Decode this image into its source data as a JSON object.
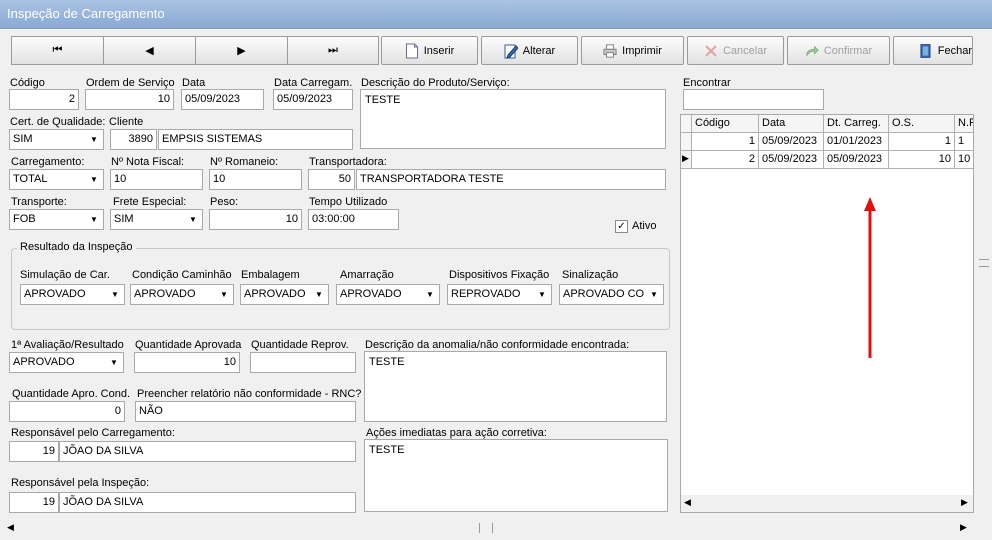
{
  "window": {
    "title": "Inspeção de Carregamento"
  },
  "nav": {
    "first": "⏮",
    "prev": "◀",
    "next": "▶",
    "last": "⏭"
  },
  "toolbar": {
    "insert": "Inserir",
    "edit": "Alterar",
    "print": "Imprimir",
    "cancel": "Cancelar",
    "confirm": "Confirmar",
    "close": "Fechar"
  },
  "form": {
    "codigo_label": "Código",
    "codigo": "2",
    "ordem_label": "Ordem de Serviço",
    "ordem": "10",
    "data_label": "Data",
    "data": "05/09/2023",
    "data_carreg_label": "Data Carregam.",
    "data_carreg": "05/09/2023",
    "descricao_label": "Descrição do Produto/Serviço:",
    "descricao": "TESTE",
    "cert_label": "Cert. de Qualidade:",
    "cert": "SIM",
    "cliente_label": "Cliente",
    "cliente_code": "3890",
    "cliente_name": "EMPSIS SISTEMAS",
    "carregamento_label": "Carregamento:",
    "carregamento": "TOTAL",
    "nota_label": "Nº Nota Fiscal:",
    "nota": "10",
    "romaneio_label": "Nº Romaneio:",
    "romaneio": "10",
    "transportadora_label": "Transportadora:",
    "transportadora_code": "50",
    "transportadora_name": "TRANSPORTADORA TESTE",
    "transporte_label": "Transporte:",
    "transporte": "FOB",
    "frete_label": "Frete Especial:",
    "frete": "SIM",
    "peso_label": "Peso:",
    "peso": "10",
    "tempo_label": "Tempo Utilizado",
    "tempo": "03:00:00",
    "ativo_label": "Ativo",
    "ativo_check": "✓"
  },
  "inspecao": {
    "title": "Resultado da Inspeção",
    "simulacao_label": "Simulação de Car.",
    "simulacao": "APROVADO",
    "condicao_label": "Condição Caminhão",
    "condicao": "APROVADO",
    "embalagem_label": "Embalagem",
    "embalagem": "APROVADO",
    "amarracao_label": "Amarração",
    "amarracao": "APROVADO",
    "dispositivos_label": "Dispositivos Fixação",
    "dispositivos": "REPROVADO",
    "sinalizacao_label": "Sinalização",
    "sinalizacao": "APROVADO CONI"
  },
  "resultado": {
    "avaliacao_label": "1ª Avaliação/Resultado",
    "avaliacao": "APROVADO",
    "qtd_aprov_label": "Quantidade Aprovada",
    "qtd_aprov": "10",
    "qtd_reprov_label": "Quantidade Reprov.",
    "qtd_reprov": "",
    "anomalia_label": "Descrição da anomalia/não conformidade encontrada:",
    "anomalia": "TESTE",
    "qtd_cond_label": "Quantidade Apro. Cond.",
    "qtd_cond": "0",
    "rnc_label": "Preencher relatório não conformidade - RNC?",
    "rnc": "NÃO",
    "resp_carreg_label": "Responsável pelo Carregamento:",
    "resp_carreg_code": "19",
    "resp_carreg_name": "JÕAO DA SILVA",
    "acoes_label": "Ações imediatas para ação corretiva:",
    "acoes": "TESTE",
    "resp_insp_label": "Responsável pela Inspeção:",
    "resp_insp_code": "19",
    "resp_insp_name": "JÕAO DA SILVA"
  },
  "search": {
    "label": "Encontrar",
    "value": ""
  },
  "grid": {
    "columns": [
      "Código",
      "Data",
      "Dt. Carreg.",
      "O.S.",
      "N.F"
    ],
    "rows": [
      [
        "1",
        "05/09/2023",
        "01/01/2023",
        "1",
        "1"
      ],
      [
        "2",
        "05/09/2023",
        "05/09/2023",
        "10",
        "10"
      ]
    ],
    "current_marker": "▶"
  },
  "colors": {
    "annotation_arrow": "#e01010",
    "title_bar": "#9db7dc"
  }
}
